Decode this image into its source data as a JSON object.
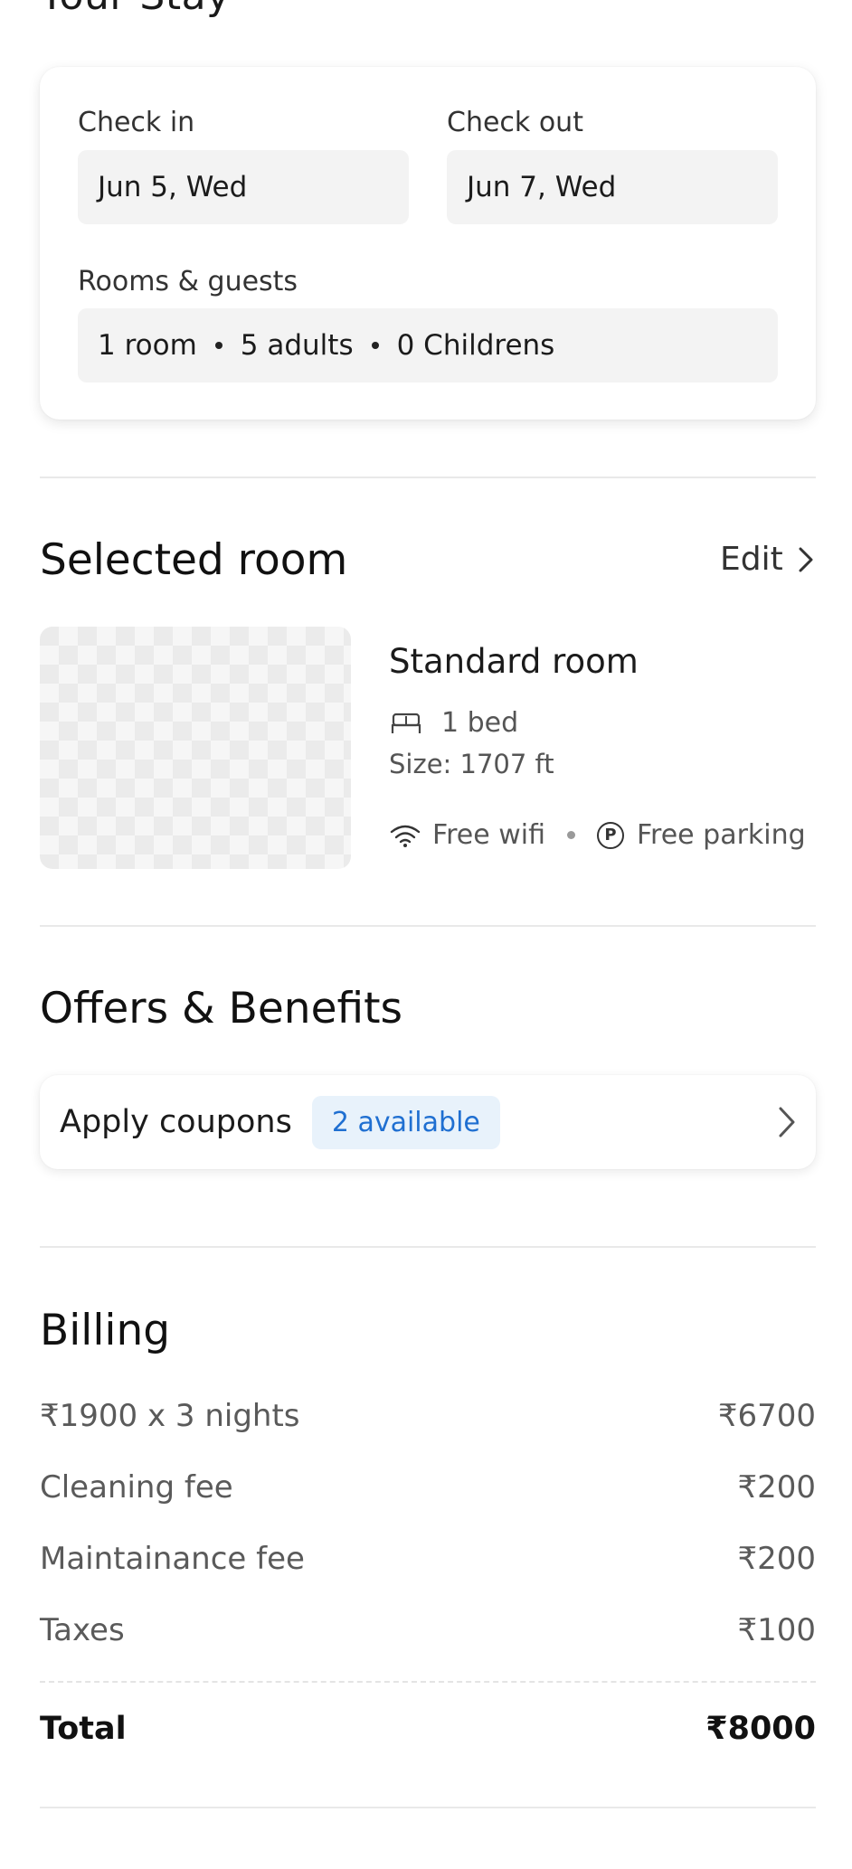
{
  "stay": {
    "title": "Your Stay",
    "check_in_label": "Check in",
    "check_in_value": "Jun 5, Wed",
    "check_out_label": "Check out",
    "check_out_value": "Jun 7, Wed",
    "rooms_label": "Rooms & guests",
    "rooms": "1 room",
    "adults": "5 adults",
    "children": "0 Childrens"
  },
  "selected_room": {
    "title": "Selected room",
    "edit_label": "Edit",
    "room_name": "Standard room",
    "beds": "1 bed",
    "size": "Size: 1707 ft",
    "amenity_1": "Free wifi",
    "amenity_2": "Free parking",
    "parking_glyph": "P"
  },
  "offers": {
    "title": "Offers & Benefits",
    "apply_label": "Apply coupons",
    "badge": "2 available",
    "badge_color": "#1f6fd1",
    "badge_bg": "#e8f2fb"
  },
  "billing": {
    "title": "Billing",
    "items": [
      {
        "label": "₹1900 x 3 nights",
        "amount": "₹6700"
      },
      {
        "label": "Cleaning fee",
        "amount": "₹200"
      },
      {
        "label": "Maintainance fee",
        "amount": "₹200"
      },
      {
        "label": "Taxes",
        "amount": "₹100"
      }
    ],
    "total_label": "Total",
    "total_amount": "₹8000"
  },
  "icons": {
    "edit_chevron": "chevron-right-icon",
    "coupon_chevron": "chevron-right-icon",
    "bed": "bed-icon",
    "wifi": "wifi-icon",
    "parking": "parking-icon"
  }
}
